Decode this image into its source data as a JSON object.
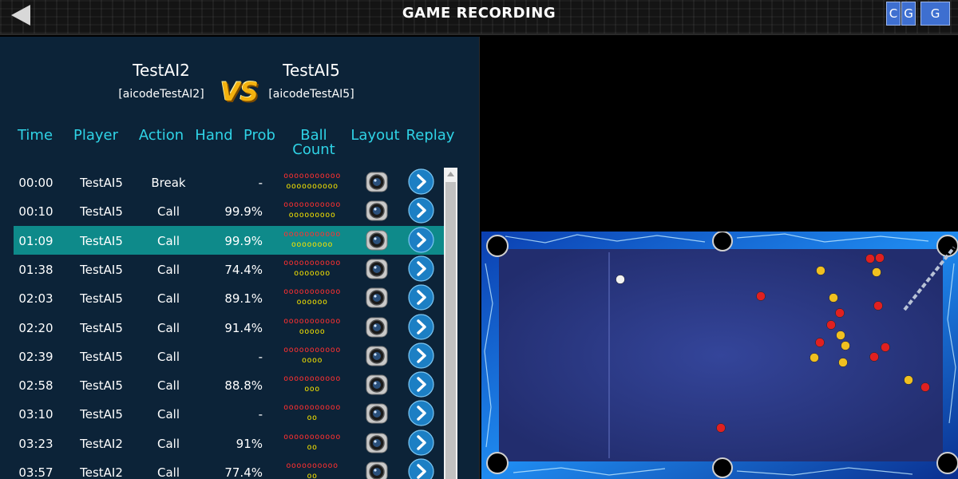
{
  "header": {
    "title": "GAME RECORDING",
    "btn_c": "C",
    "btn_g1": "G",
    "btn_g2": "G"
  },
  "match": {
    "player1": {
      "name": "TestAI2",
      "code": "[aicodeTestAI2]"
    },
    "vs": "VS",
    "player2": {
      "name": "TestAI5",
      "code": "[aicodeTestAI5]"
    }
  },
  "columns": [
    "Time",
    "Player",
    "Action",
    "Hand",
    "Prob",
    "Ball",
    "Count",
    "Layout",
    "Replay"
  ],
  "rows": [
    {
      "time": "00:00",
      "player": "TestAI5",
      "action": "Break",
      "prob": "-",
      "red": "ooooooooooo",
      "yellow": "oooooooooo"
    },
    {
      "time": "00:10",
      "player": "TestAI5",
      "action": "Call",
      "prob": "99.9%",
      "red": "ooooooooooo",
      "yellow": "ooooooooo"
    },
    {
      "time": "01:09",
      "player": "TestAI5",
      "action": "Call",
      "prob": "99.9%",
      "red": "ooooooooooo",
      "yellow": "oooooooo"
    },
    {
      "time": "01:38",
      "player": "TestAI5",
      "action": "Call",
      "prob": "74.4%",
      "red": "ooooooooooo",
      "yellow": "ooooooo"
    },
    {
      "time": "02:03",
      "player": "TestAI5",
      "action": "Call",
      "prob": "89.1%",
      "red": "ooooooooooo",
      "yellow": "oooooo"
    },
    {
      "time": "02:20",
      "player": "TestAI5",
      "action": "Call",
      "prob": "91.4%",
      "red": "ooooooooooo",
      "yellow": "ooooo"
    },
    {
      "time": "02:39",
      "player": "TestAI5",
      "action": "Call",
      "prob": "-",
      "red": "ooooooooooo",
      "yellow": "oooo"
    },
    {
      "time": "02:58",
      "player": "TestAI5",
      "action": "Call",
      "prob": "88.8%",
      "red": "ooooooooooo",
      "yellow": "ooo"
    },
    {
      "time": "03:10",
      "player": "TestAI5",
      "action": "Call",
      "prob": "-",
      "red": "ooooooooooo",
      "yellow": "oo"
    },
    {
      "time": "03:23",
      "player": "TestAI2",
      "action": "Call",
      "prob": "91%",
      "red": "ooooooooooo",
      "yellow": "oo"
    },
    {
      "time": "03:57",
      "player": "TestAI2",
      "action": "Call",
      "prob": "77.4%",
      "red": "oooooooooo",
      "yellow": "oo"
    }
  ],
  "selected_row": 2,
  "colors": {
    "accent": "#2fd3e6",
    "selected_row": "#0e8a8a",
    "panel_bg": "#0c2338",
    "header_btn": "#3e6fd0",
    "table_felt": "#2f3f8f"
  }
}
